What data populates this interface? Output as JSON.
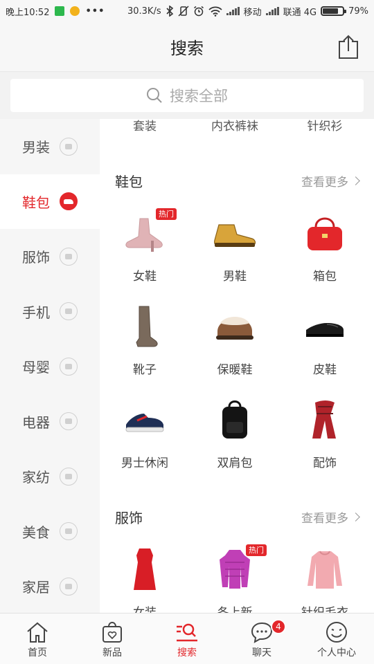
{
  "status_bar": {
    "time": "晚上10:52",
    "dots": "•••",
    "speed": "30.3K/s",
    "carrier1": "移动",
    "carrier2": "联通 4G",
    "battery": "79%",
    "battery_level": 0.79
  },
  "header": {
    "title": "搜索"
  },
  "search": {
    "placeholder": "搜索全部"
  },
  "sidebar": {
    "items": [
      {
        "label": "男装",
        "icon": "suit-icon"
      },
      {
        "label": "鞋包",
        "icon": "shoe-icon"
      },
      {
        "label": "服饰",
        "icon": "shirt-icon"
      },
      {
        "label": "手机",
        "icon": "phone-icon"
      },
      {
        "label": "母婴",
        "icon": "baby-bottle-icon"
      },
      {
        "label": "电器",
        "icon": "appliance-icon"
      },
      {
        "label": "家纺",
        "icon": "bell-icon"
      },
      {
        "label": "美食",
        "icon": "food-icon"
      },
      {
        "label": "家居",
        "icon": "furniture-icon"
      }
    ],
    "active_index": 1
  },
  "main": {
    "top_row": [
      "套装",
      "内衣裤袜",
      "针织衫"
    ],
    "sections": [
      {
        "title": "鞋包",
        "more": "查看更多",
        "items": [
          {
            "label": "女鞋",
            "hot": "热门",
            "icon": "heel-boot-icon"
          },
          {
            "label": "男鞋",
            "icon": "work-boot-icon"
          },
          {
            "label": "箱包",
            "icon": "handbag-icon"
          },
          {
            "label": "靴子",
            "icon": "tall-boot-icon"
          },
          {
            "label": "保暖鞋",
            "icon": "fur-slipper-icon"
          },
          {
            "label": "皮鞋",
            "icon": "leather-shoe-icon"
          },
          {
            "label": "男士休闲",
            "icon": "sneaker-icon"
          },
          {
            "label": "双肩包",
            "icon": "backpack-icon"
          },
          {
            "label": "配饰",
            "icon": "scarf-icon"
          }
        ]
      },
      {
        "title": "服饰",
        "more": "查看更多",
        "items": [
          {
            "label": "女装",
            "icon": "dress-icon"
          },
          {
            "label": "冬上新",
            "hot": "热门",
            "icon": "puffer-jacket-icon"
          },
          {
            "label": "针织毛衣",
            "icon": "sweater-icon"
          }
        ]
      }
    ]
  },
  "tabbar": {
    "tabs": [
      {
        "label": "首页",
        "icon": "home-icon"
      },
      {
        "label": "新品",
        "icon": "bag-heart-icon"
      },
      {
        "label": "搜索",
        "icon": "search-icon"
      },
      {
        "label": "聊天",
        "icon": "chat-icon",
        "badge": "4"
      },
      {
        "label": "个人中心",
        "icon": "smiley-icon"
      }
    ],
    "active_index": 2
  },
  "colors": {
    "accent": "#e3272b",
    "sidebar_bg": "#f6f6f6",
    "header_bg": "#f7f7f7"
  }
}
